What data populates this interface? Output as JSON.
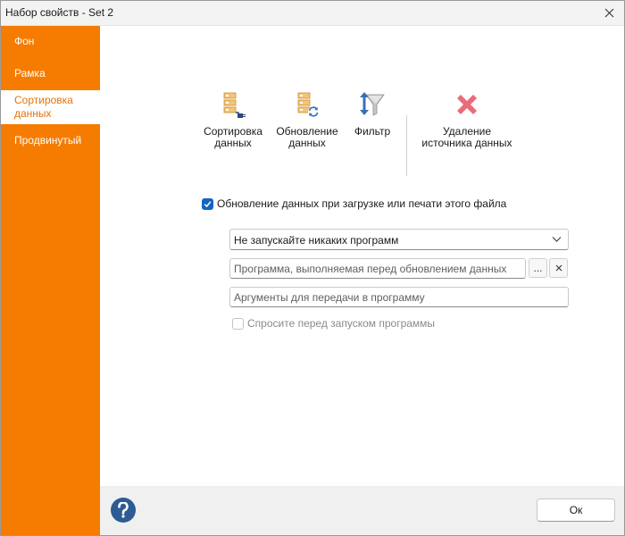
{
  "window": {
    "title": "Набор свойств - Set 2"
  },
  "sidebar": {
    "items": [
      {
        "label": "Фон"
      },
      {
        "label": "Рамка"
      },
      {
        "label_line1": "Сортировка",
        "label_line2": "данных"
      },
      {
        "label": "Продвинутый"
      }
    ],
    "active_index": 2,
    "color": "#f57c00"
  },
  "toolbar": {
    "sort": {
      "line1": "Сортировка",
      "line2": "данных",
      "icon": "sort-data-icon"
    },
    "refresh": {
      "line1": "Обновление",
      "line2": "данных",
      "icon": "refresh-data-icon"
    },
    "filter": {
      "label": "Фильтр",
      "icon": "filter-icon"
    },
    "remove": {
      "line1": "Удаление",
      "line2": "источника данных",
      "icon": "delete-x-icon"
    }
  },
  "refresh_on_load": {
    "label": "Обновление данных при загрузке или печати этого файла",
    "checked": true
  },
  "program_select": {
    "value": "Не запускайте никаких программ"
  },
  "program_field": {
    "placeholder": "Программа, выполняемая перед обновлением данных",
    "browse_label": "..."
  },
  "args_field": {
    "placeholder": "Аргументы для передачи в программу"
  },
  "ask_before": {
    "label": "Спросите перед запуском программы",
    "checked": false,
    "disabled": true
  },
  "footer": {
    "ok_label": "Ок"
  }
}
